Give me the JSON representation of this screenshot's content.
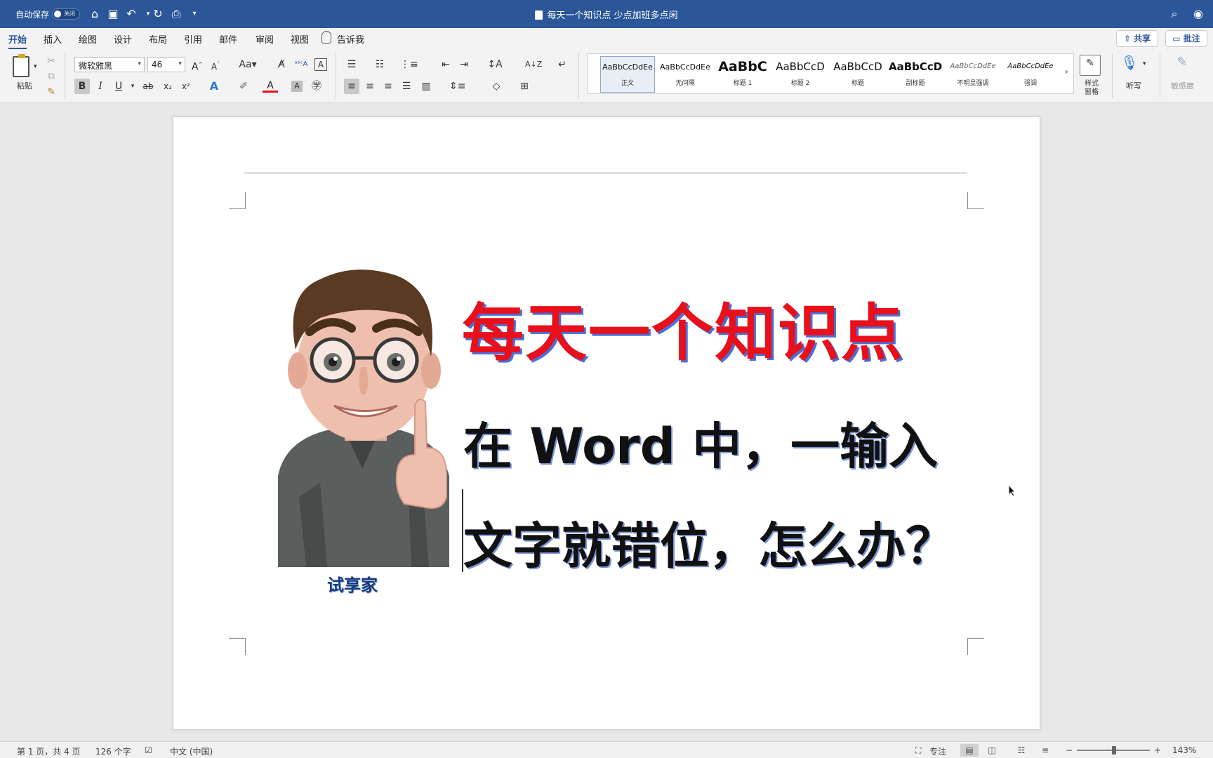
{
  "titlebar": {
    "autosave_label": "自动保存",
    "autosave_state": "关闭",
    "doc_title": "每天一个知识点 少点加班多点闲",
    "icons": [
      "home-icon",
      "save-icon",
      "undo-icon",
      "redo-icon",
      "print-icon",
      "customize-icon",
      "search-icon",
      "account-icon"
    ]
  },
  "tabs": [
    "开始",
    "插入",
    "绘图",
    "设计",
    "布局",
    "引用",
    "邮件",
    "审阅",
    "视图"
  ],
  "tell_me": "告诉我",
  "share_label": "共享",
  "comment_label": "批注",
  "ribbon": {
    "paste_label": "粘贴",
    "font_name": "微软雅黑",
    "font_size": "46",
    "styles": [
      {
        "sample": "AaBbCcDdEe",
        "name": "正文"
      },
      {
        "sample": "AaBbCcDdEe",
        "name": "无间隔"
      },
      {
        "sample": "AaBbC",
        "name": "标题 1"
      },
      {
        "sample": "AaBbCcD",
        "name": "标题 2"
      },
      {
        "sample": "AaBbCcD",
        "name": "标题"
      },
      {
        "sample": "AaBbCcD",
        "name": "副标题"
      },
      {
        "sample": "AaBbCcDdEe",
        "name": "不明显强调"
      },
      {
        "sample": "AaBbCcDdEe",
        "name": "强调"
      }
    ],
    "styles_pane_label": "样式\n窗格",
    "dictate_label": "听写",
    "sensitivity_label": "敏感度"
  },
  "document": {
    "headline": "每天一个知识点",
    "line2": "在 Word 中，一输入",
    "line3": "文字就错位，怎么办？",
    "brand": "试享家"
  },
  "status": {
    "page_info": "第 1 页，共 4 页",
    "word_count": "126 个字",
    "language": "中文 (中国)",
    "focus_label": "专注",
    "zoom": "143%"
  },
  "colors": {
    "brand_blue": "#2b579a",
    "headline_red": "#e8101a"
  }
}
